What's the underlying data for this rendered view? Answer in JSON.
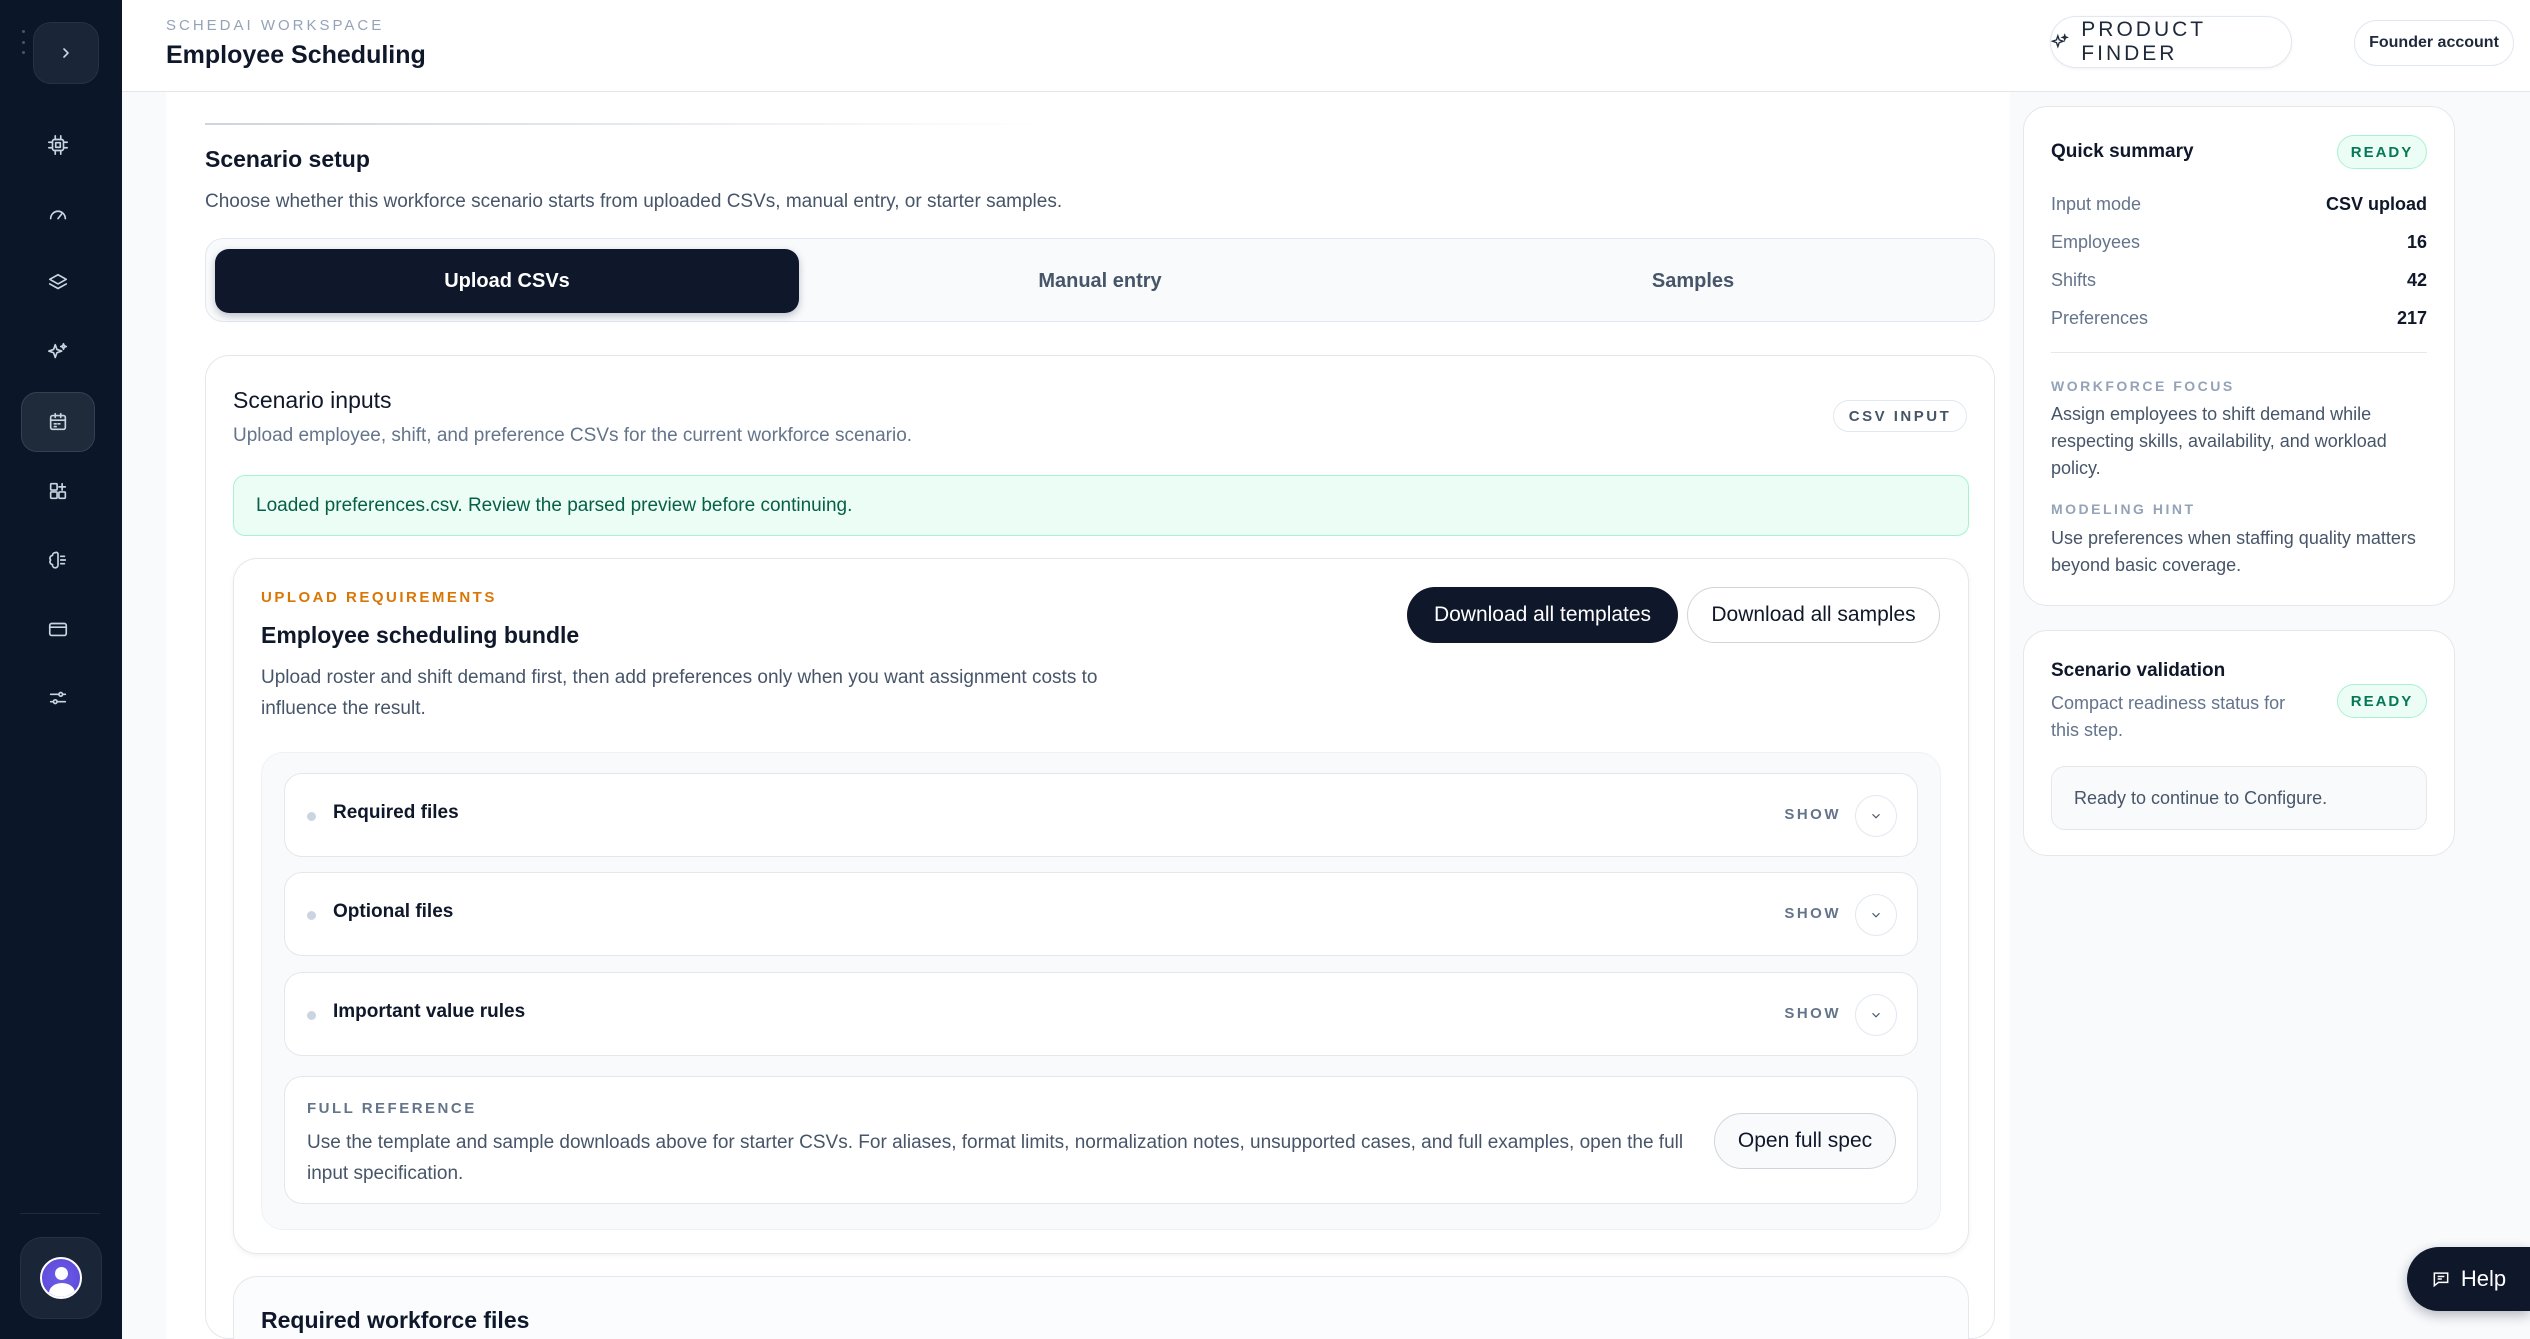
{
  "header": {
    "workspace_label": "SCHEDAI WORKSPACE",
    "title": "Employee Scheduling",
    "product_finder": "PRODUCT FINDER",
    "account": "Founder account"
  },
  "sidebar": {
    "items": [
      {
        "icon": "cpu-icon"
      },
      {
        "icon": "gauge-icon"
      },
      {
        "icon": "layers-icon"
      },
      {
        "icon": "sparkles-icon"
      },
      {
        "icon": "calendar-icon",
        "active": true
      },
      {
        "icon": "grid-plus-icon"
      },
      {
        "icon": "brain-icon"
      },
      {
        "icon": "credit-card-icon"
      },
      {
        "icon": "sliders-icon"
      }
    ]
  },
  "setup": {
    "title": "Scenario setup",
    "description": "Choose whether this workforce scenario starts from uploaded CSVs, manual entry, or starter samples.",
    "tabs": [
      "Upload CSVs",
      "Manual entry",
      "Samples"
    ],
    "active_tab": "Upload CSVs"
  },
  "inputs": {
    "title": "Scenario inputs",
    "description": "Upload employee, shift, and preference CSVs for the current workforce scenario.",
    "badge": "CSV INPUT",
    "alert": "Loaded preferences.csv. Review the parsed preview before continuing."
  },
  "requirements": {
    "label": "UPLOAD REQUIREMENTS",
    "title": "Employee scheduling bundle",
    "description": "Upload roster and shift demand first, then add preferences only when you want assignment costs to influence the result.",
    "download_templates": "Download all templates",
    "download_samples": "Download all samples",
    "accordions": [
      {
        "label": "Required files",
        "toggle": "SHOW"
      },
      {
        "label": "Optional files",
        "toggle": "SHOW"
      },
      {
        "label": "Important value rules",
        "toggle": "SHOW"
      }
    ],
    "reference": {
      "label": "FULL REFERENCE",
      "description": "Use the template and sample downloads above for starter CSVs. For aliases, format limits, normalization notes, unsupported cases, and full examples, open the full input specification.",
      "button": "Open full spec"
    }
  },
  "required_workforce": {
    "title": "Required workforce files"
  },
  "quick_summary": {
    "title": "Quick summary",
    "badge": "READY",
    "rows": [
      {
        "key": "Input mode",
        "value": "CSV upload"
      },
      {
        "key": "Employees",
        "value": "16"
      },
      {
        "key": "Shifts",
        "value": "42"
      },
      {
        "key": "Preferences",
        "value": "217"
      }
    ],
    "focus_label": "WORKFORCE FOCUS",
    "focus_text": "Assign employees to shift demand while respecting skills, availability, and workload policy.",
    "hint_label": "MODELING HINT",
    "hint_text": "Use preferences when staffing quality matters beyond basic coverage."
  },
  "validation": {
    "title": "Scenario validation",
    "description": "Compact readiness status for this step.",
    "badge": "READY",
    "status": "Ready to continue to Configure."
  },
  "help": {
    "label": "Help"
  },
  "colors": {
    "sidebar_bg": "#0b1628",
    "primary": "#0f172a",
    "accent_amber": "#d97706",
    "success_bg": "#ecfdf5",
    "success_text": "#047857"
  }
}
